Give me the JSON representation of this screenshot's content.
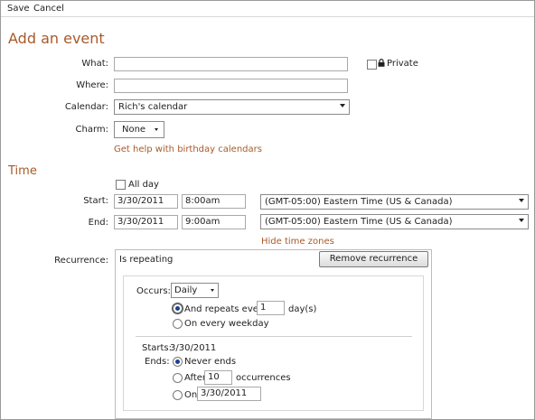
{
  "toolbar": {
    "save_label": "Save",
    "cancel_label": "Cancel"
  },
  "page_title": "Add an event",
  "event": {
    "what_label": "What:",
    "what_value": "",
    "where_label": "Where:",
    "where_value": "",
    "private_label": "Private",
    "calendar_label": "Calendar:",
    "calendar_value": "Rich's calendar",
    "charm_label": "Charm:",
    "charm_value": "None",
    "birthday_link": "Get help with birthday calendars"
  },
  "time": {
    "section_title": "Time",
    "all_day_label": "All day",
    "start_label": "Start:",
    "start_date": "3/30/2011",
    "start_time": "8:00am",
    "start_zone": "(GMT-05:00) Eastern Time (US & Canada)",
    "end_label": "End:",
    "end_date": "3/30/2011",
    "end_time": "9:00am",
    "end_zone": "(GMT-05:00) Eastern Time (US & Canada)",
    "hide_zones_link": "Hide time zones"
  },
  "recurrence": {
    "label": "Recurrence:",
    "status": "Is repeating",
    "remove_button": "Remove recurrence",
    "occurs_label": "Occurs:",
    "occurs_value": "Daily",
    "repeats_every_label": "And repeats every",
    "repeats_every_value": "1",
    "repeats_unit": "day(s)",
    "weekday_label": "On every weekday",
    "starts_label": "Starts:",
    "starts_value": "3/30/2011",
    "ends_label": "Ends:",
    "never_ends_label": "Never ends",
    "after_label": "After",
    "after_value": "10",
    "occurrences_label": "occurrences",
    "on_label": "On",
    "on_value": "3/30/2011"
  }
}
